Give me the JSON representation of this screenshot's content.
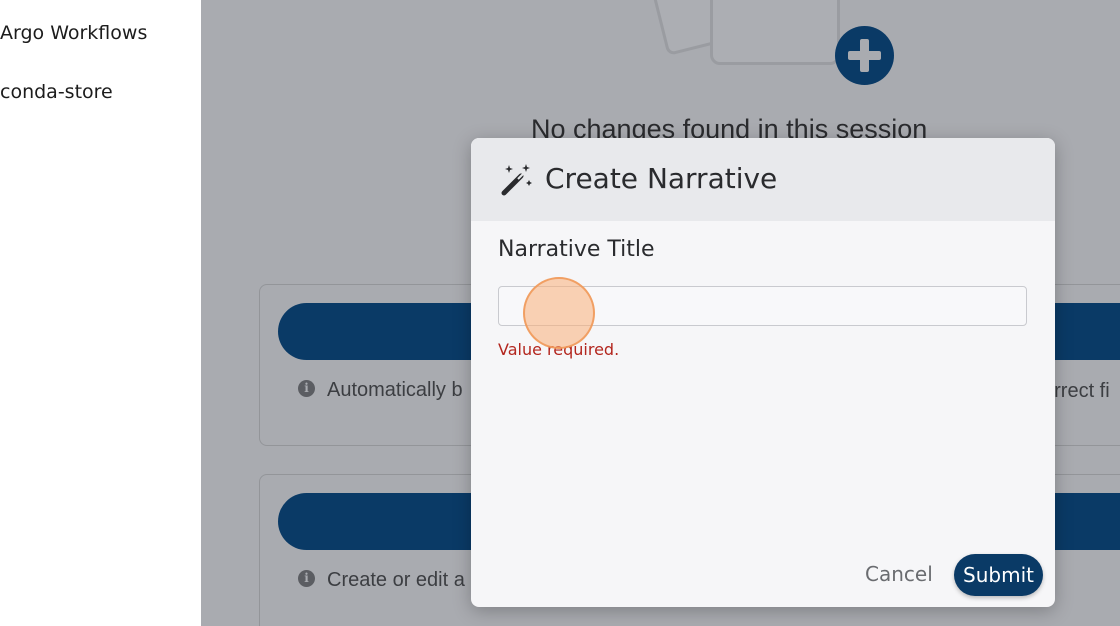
{
  "sidebar": {
    "items": [
      {
        "label": "Argo Workflows"
      },
      {
        "label": "conda-store"
      }
    ]
  },
  "main": {
    "empty_state": {
      "title": "No changes found in this session",
      "add_icon": "plus-circle-icon"
    },
    "cards": [
      {
        "info_text": "Automatically b",
        "info_right_text": "orrect fi"
      },
      {
        "info_text": "Create or edit a"
      }
    ]
  },
  "dialog": {
    "title": "Create Narrative",
    "title_icon": "magic-wand-icon",
    "field_label": "Narrative Title",
    "input_value": "",
    "input_placeholder": "",
    "error": "Value required.",
    "cancel_label": "Cancel",
    "submit_label": "Submit"
  },
  "colors": {
    "primary": "#0a3a66",
    "error": "#b3261e",
    "overlay": "#a9abb0",
    "dialog_header": "#e8e9ec"
  }
}
